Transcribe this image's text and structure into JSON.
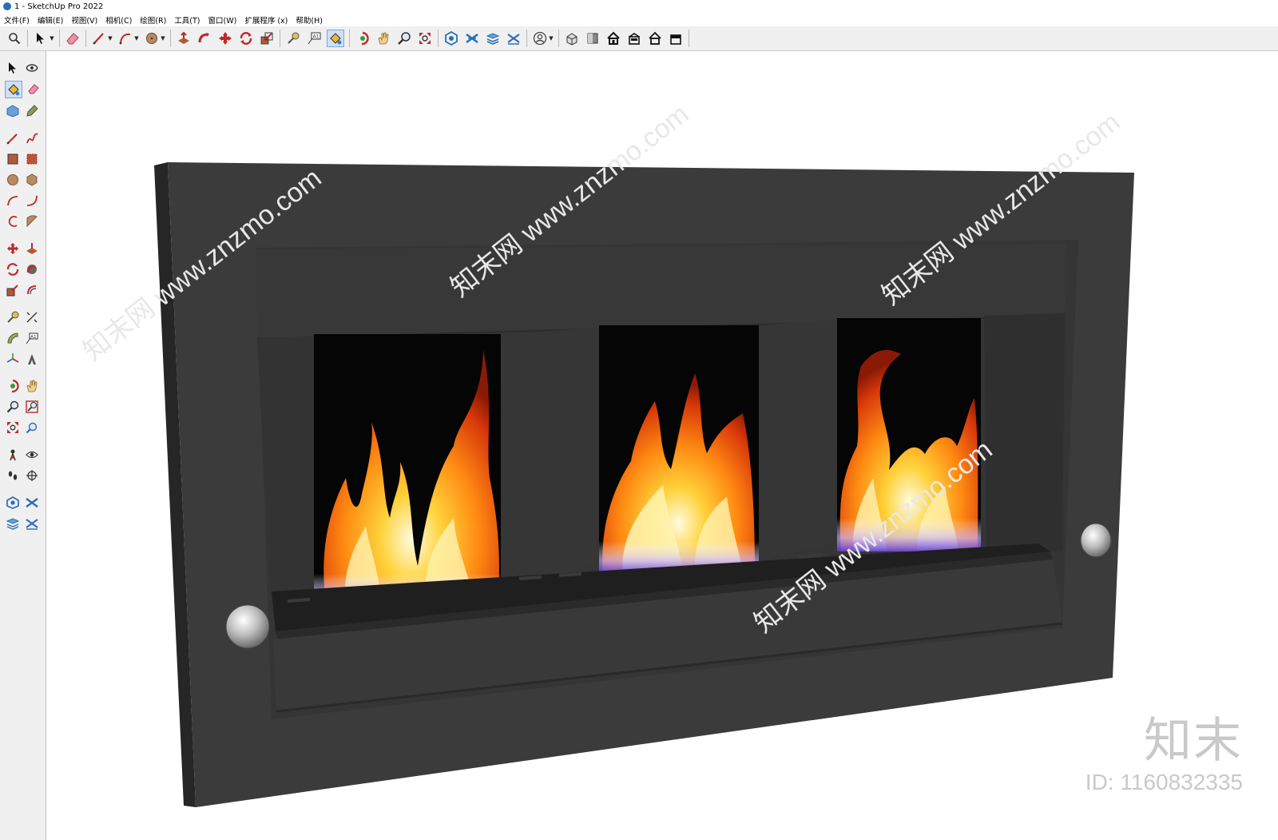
{
  "window": {
    "title": "1 - SketchUp Pro 2022"
  },
  "menu": [
    "文件(F)",
    "编辑(E)",
    "视图(V)",
    "相机(C)",
    "绘图(R)",
    "工具(T)",
    "窗口(W)",
    "扩展程序 (x)",
    "帮助(H)"
  ],
  "toolbar": {
    "tools": [
      "search",
      "select",
      "eraser",
      "pencil",
      "arc",
      "circle",
      "push-pull",
      "follow-me",
      "move",
      "rotate",
      "scale",
      "tape-measure",
      "text",
      "paint-bucket",
      "orbit",
      "pan",
      "zoom",
      "zoom-extents",
      "warehouse",
      "extension-warehouse",
      "layer-manager",
      "sandbox",
      "account",
      "iso-view",
      "top-view",
      "front-view",
      "right-view",
      "back-view",
      "left-view"
    ],
    "active": "paint-bucket"
  },
  "sidebar": {
    "tools": [
      "select",
      "orbit",
      "paint-bucket",
      "eraser",
      "component",
      "tag",
      "line",
      "freehand",
      "rectangle",
      "rotated-rectangle",
      "circle",
      "polygon",
      "arc",
      "pie-arc",
      "two-point-arc",
      "three-point-arc",
      "move",
      "push-pull",
      "rotate",
      "follow-me",
      "scale",
      "offset",
      "tape-measure",
      "dimension",
      "protractor",
      "text",
      "axes",
      "3d-text",
      "orbit-small",
      "pan",
      "zoom",
      "zoom-window",
      "zoom-extents",
      "previous",
      "position-camera",
      "look-around",
      "walk",
      "section-plane",
      "warehouse",
      "extension-warehouse",
      "layer-manager",
      "sandbox"
    ]
  },
  "watermark": {
    "logo": "知末",
    "id": "ID: 1160832335",
    "diagonal": "知末网 www.znzmo.com"
  },
  "colors": {
    "frame": "#3b3b3b",
    "frame_dark": "#2f2f2f",
    "frame_shadow": "#262626",
    "flame_bg": "#050505",
    "accent_blue": "#2a6fb6"
  }
}
